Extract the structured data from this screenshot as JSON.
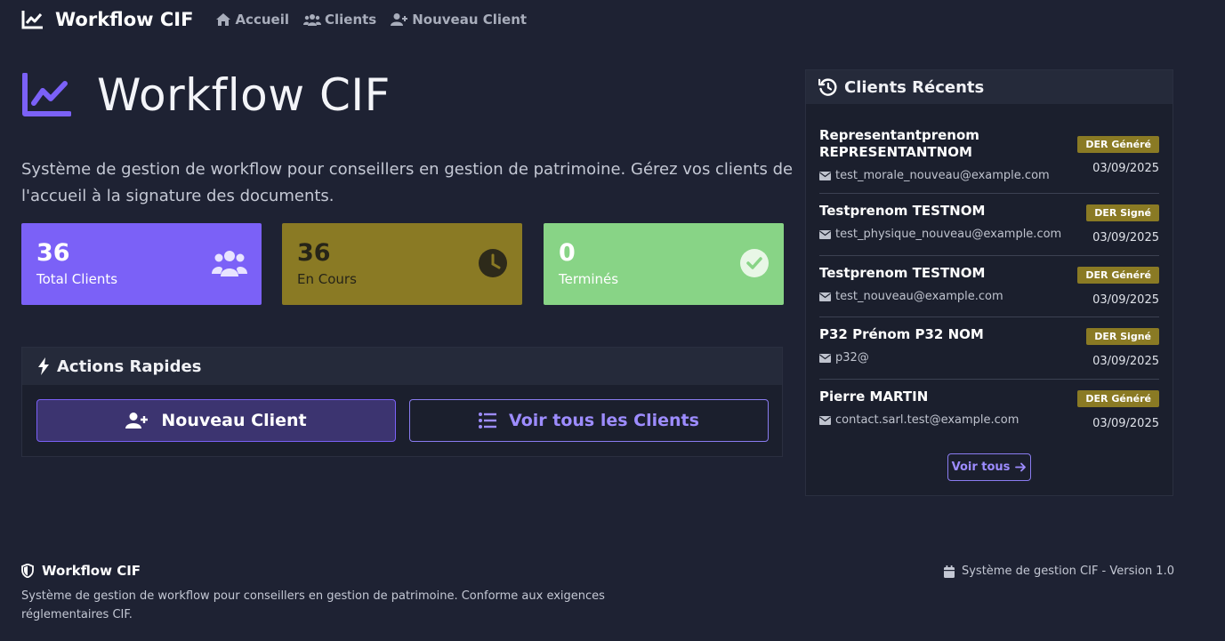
{
  "nav": {
    "brand": "Workflow CIF",
    "links": [
      {
        "label": "Accueil",
        "icon": "home-icon"
      },
      {
        "label": "Clients",
        "icon": "users-icon"
      },
      {
        "label": "Nouveau Client",
        "icon": "user-plus-icon"
      }
    ]
  },
  "hero": {
    "title": "Workflow CIF",
    "description": "Système de gestion de workflow pour conseillers en gestion de patrimoine. Gérez vos clients de l'accueil à la signature des documents."
  },
  "stats": [
    {
      "value": "36",
      "label": "Total Clients",
      "icon": "users-icon",
      "color": "#7b61f7"
    },
    {
      "value": "36",
      "label": "En Cours",
      "icon": "clock-icon",
      "color": "#8a7a24"
    },
    {
      "value": "0",
      "label": "Terminés",
      "icon": "check-circle-icon",
      "color": "#88d486"
    }
  ],
  "actions": {
    "title": "Actions Rapides",
    "new_client": "Nouveau Client",
    "all_clients": "Voir tous les Clients"
  },
  "recent": {
    "title": "Clients Récents",
    "clients": [
      {
        "name": "Representantprenom REPRESENTANTNOM",
        "email": "test_morale_nouveau@example.com",
        "badge": "DER Généré",
        "date": "03/09/2025"
      },
      {
        "name": "Testprenom TESTNOM",
        "email": "test_physique_nouveau@example.com",
        "badge": "DER Signé",
        "date": "03/09/2025"
      },
      {
        "name": "Testprenom TESTNOM",
        "email": "test_nouveau@example.com",
        "badge": "DER Généré",
        "date": "03/09/2025"
      },
      {
        "name": "P32 Prénom P32 NOM",
        "email": "p32@",
        "badge": "DER Signé",
        "date": "03/09/2025"
      },
      {
        "name": "Pierre MARTIN",
        "email": "contact.sarl.test@example.com",
        "badge": "DER Généré",
        "date": "03/09/2025"
      }
    ],
    "view_all": "Voir tous"
  },
  "footer": {
    "title": "Workflow CIF",
    "description": "Système de gestion de workflow pour conseillers en gestion de patrimoine. Conforme aux exigences réglementaires CIF.",
    "version": "Système de gestion CIF - Version 1.0"
  },
  "colors": {
    "accent": "#7b61f7",
    "warning": "#8a7a24",
    "success": "#88d486",
    "background": "#1e2233"
  }
}
